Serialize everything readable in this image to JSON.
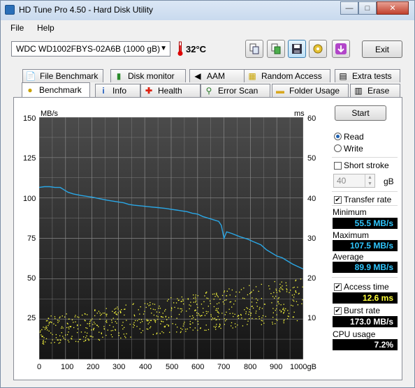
{
  "window": {
    "title": "HD Tune Pro 4.50 - Hard Disk Utility",
    "min_glyph": "—",
    "max_glyph": "□",
    "close_glyph": "✕"
  },
  "menu": {
    "file": "File",
    "help": "Help"
  },
  "toolbar": {
    "drive": "WDC     WD1002FBYS-02A6B (1000 gB)",
    "temperature": "32°C",
    "exit_label": "Exit",
    "buttons": [
      "copy-text-icon",
      "copy-screenshot-icon",
      "save-icon",
      "options-icon",
      "download-icon"
    ]
  },
  "tabs_top": [
    {
      "label": "File Benchmark",
      "icon": "file-benchmark-icon"
    },
    {
      "label": "Disk monitor",
      "icon": "disk-monitor-icon"
    },
    {
      "label": "AAM",
      "icon": "speaker-icon"
    },
    {
      "label": "Random Access",
      "icon": "random-access-icon"
    },
    {
      "label": "Extra tests",
      "icon": "extra-tests-icon"
    }
  ],
  "tabs_bottom": [
    {
      "label": "Benchmark",
      "icon": "benchmark-icon",
      "active": true
    },
    {
      "label": "Info",
      "icon": "info-icon"
    },
    {
      "label": "Health",
      "icon": "health-icon"
    },
    {
      "label": "Error Scan",
      "icon": "magnifier-icon"
    },
    {
      "label": "Folder Usage",
      "icon": "folder-icon"
    },
    {
      "label": "Erase",
      "icon": "trash-icon"
    }
  ],
  "controls": {
    "start_label": "Start",
    "read_label": "Read",
    "write_label": "Write",
    "mode": "read",
    "short_stroke_label": "Short stroke",
    "short_stroke_checked": false,
    "short_stroke_value": "40",
    "short_stroke_unit": "gB",
    "transfer_rate_label": "Transfer rate",
    "transfer_rate_checked": true,
    "minimum_label": "Minimum",
    "minimum_value": "55.5 MB/s",
    "maximum_label": "Maximum",
    "maximum_value": "107.5 MB/s",
    "average_label": "Average",
    "average_value": "89.9 MB/s",
    "access_time_label": "Access time",
    "access_time_checked": true,
    "access_time_value": "12.6 ms",
    "burst_rate_label": "Burst rate",
    "burst_rate_checked": true,
    "burst_rate_value": "173.0 MB/s",
    "cpu_usage_label": "CPU usage",
    "cpu_usage_value": "7.2%"
  },
  "colors": {
    "transfer_line": "#2aa7e6",
    "access_points": "#ffff3c",
    "plot_bg_top": "#4b4b4b",
    "plot_bg_bottom": "#151515",
    "grid": "#8a8a8a"
  },
  "chart_data": {
    "type": "line",
    "y_left_label": "MB/s",
    "y_right_label": "ms",
    "x_unit": "gB",
    "x_ticks": [
      "0",
      "100",
      "200",
      "300",
      "400",
      "500",
      "600",
      "700",
      "800",
      "900",
      "1000gB"
    ],
    "y_left_ticks": [
      "150",
      "125",
      "100",
      "75",
      "50",
      "25"
    ],
    "y_right_ticks": [
      "60",
      "50",
      "40",
      "30",
      "20",
      "10"
    ],
    "xlim": [
      0,
      1000
    ],
    "ylim_left": [
      0,
      150
    ],
    "ylim_right": [
      0,
      60
    ],
    "grid": true,
    "series": [
      {
        "name": "Transfer rate",
        "axis": "left",
        "x": [
          0,
          20,
          40,
          60,
          80,
          100,
          110,
          130,
          160,
          200,
          230,
          260,
          300,
          320,
          340,
          360,
          390,
          420,
          450,
          480,
          500,
          520,
          540,
          560,
          580,
          600,
          620,
          640,
          660,
          680,
          690,
          700,
          710,
          730,
          760,
          790,
          810,
          840,
          860,
          880,
          900,
          920,
          940,
          960,
          980,
          1000
        ],
        "values": [
          106.5,
          107,
          107,
          106.5,
          106.5,
          104.5,
          103.5,
          102.5,
          101.5,
          100.5,
          99.5,
          98.5,
          97.5,
          97,
          96,
          95.5,
          95,
          94.5,
          94,
          93.5,
          93,
          92.5,
          92,
          91.5,
          90.5,
          90,
          88.5,
          87.5,
          86.5,
          85.5,
          83,
          75,
          79,
          78,
          76,
          74.5,
          73,
          71,
          68,
          66,
          64,
          63,
          61,
          59,
          57.5,
          56
        ]
      }
    ],
    "access_time_ms_range": [
      3.5,
      22
    ],
    "burst_rate_mb_s": 173.0
  }
}
